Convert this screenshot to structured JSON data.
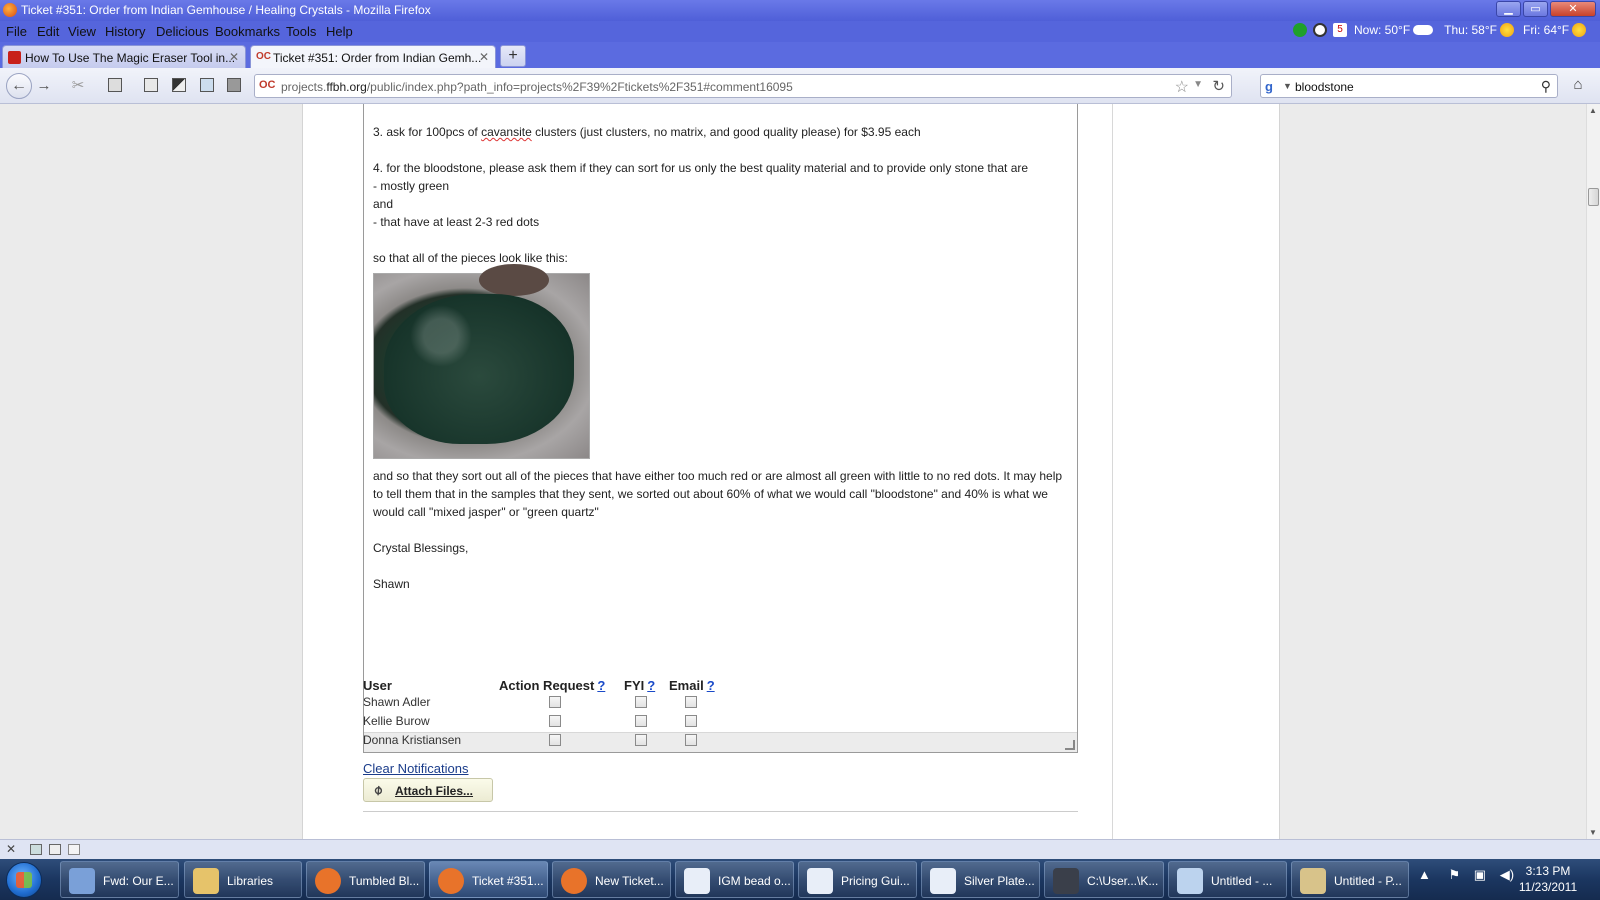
{
  "window": {
    "title": "Ticket #351: Order from Indian Gemhouse / Healing Crystals - Mozilla Firefox",
    "minimize": "▁",
    "maximize": "▭",
    "close": "✕"
  },
  "menu": {
    "items": [
      "File",
      "Edit",
      "View",
      "History",
      "Delicious",
      "Bookmarks",
      "Tools",
      "Help"
    ],
    "weather": {
      "now": "Now: 50°F",
      "thu": "Thu: 58°F",
      "fri": "Fri: 64°F",
      "calendar_day": "5"
    }
  },
  "tabs": [
    {
      "label": "How To Use The Magic Eraser Tool in...",
      "active": false,
      "icon": "youtube-icon"
    },
    {
      "label": "Ticket #351: Order from Indian Gemh...",
      "active": true,
      "icon": "activecollab-icon"
    }
  ],
  "new_tab_label": "+",
  "nav": {
    "url_prefix": "projects.",
    "url_domain": "ffbh.org",
    "url_path": "/public/index.php?path_info=projects%2F39%2Ftickets%2F351#comment16095",
    "site_icon_text": "OC",
    "search_value": "bloodstone",
    "search_engine_icon": "google-icon"
  },
  "editor": {
    "line1_prefix": "3.  ask for 100pcs of ",
    "line1_misspelled": "cavansite",
    "line1_suffix": " clusters (just clusters, no matrix, and good quality please) for $3.95 each",
    "line2": "4. for the bloodstone, please ask them if they can sort for us only the best quality material and to provide only stone that are",
    "line3": "- mostly green",
    "line4": "and",
    "line5": "- that have at least 2-3 red dots",
    "line6": "so that all of the pieces look like this:",
    "para2": "and so that they sort out all of the pieces that have either too much red or are almost all green with little to no red dots.    It may help to tell them that in the samples that they sent, we sorted out about 60% of what we would call \"bloodstone\" and 40% is what we would call \"mixed jasper\" or \"green quartz\"",
    "closing": "Crystal Blessings,",
    "signature": "Shawn"
  },
  "notifications": {
    "headers": {
      "user": "User",
      "action": "Action Request",
      "fyi": "FYI",
      "email": "Email",
      "help": "?"
    },
    "users": [
      "Shawn Adler",
      "Kellie Burow",
      "Donna Kristiansen"
    ]
  },
  "clear_notifications": "Clear Notifications",
  "attach_files": "Attach Files...",
  "taskbar": {
    "items": [
      {
        "label": "Fwd: Our E...",
        "icon": "thunderbird-icon",
        "color": "#7aa0d8",
        "active": false
      },
      {
        "label": "Libraries",
        "icon": "folder-icon",
        "color": "#e6c36a",
        "active": false
      },
      {
        "label": "Tumbled Bl...",
        "icon": "firefox-icon",
        "color": "#e8732a",
        "active": false
      },
      {
        "label": "Ticket #351...",
        "icon": "firefox-icon",
        "color": "#e8732a",
        "active": true
      },
      {
        "label": "New Ticket...",
        "icon": "firefox-icon",
        "color": "#e8732a",
        "active": false
      },
      {
        "label": "IGM bead o...",
        "icon": "spreadsheet-icon",
        "color": "#e8eef8",
        "active": false
      },
      {
        "label": "Pricing Gui...",
        "icon": "spreadsheet-icon",
        "color": "#e8eef8",
        "active": false
      },
      {
        "label": "Silver Plate...",
        "icon": "spreadsheet-icon",
        "color": "#e8eef8",
        "active": false
      },
      {
        "label": "C:\\User...\\K...",
        "icon": "lock-icon",
        "color": "#3a3f4a",
        "active": false
      },
      {
        "label": "Untitled - ...",
        "icon": "notepad-icon",
        "color": "#bcd3ee",
        "active": false
      },
      {
        "label": "Untitled - P...",
        "icon": "paint-icon",
        "color": "#d8c38a",
        "active": false
      }
    ],
    "clock_time": "3:13 PM",
    "clock_date": "11/23/2011"
  }
}
